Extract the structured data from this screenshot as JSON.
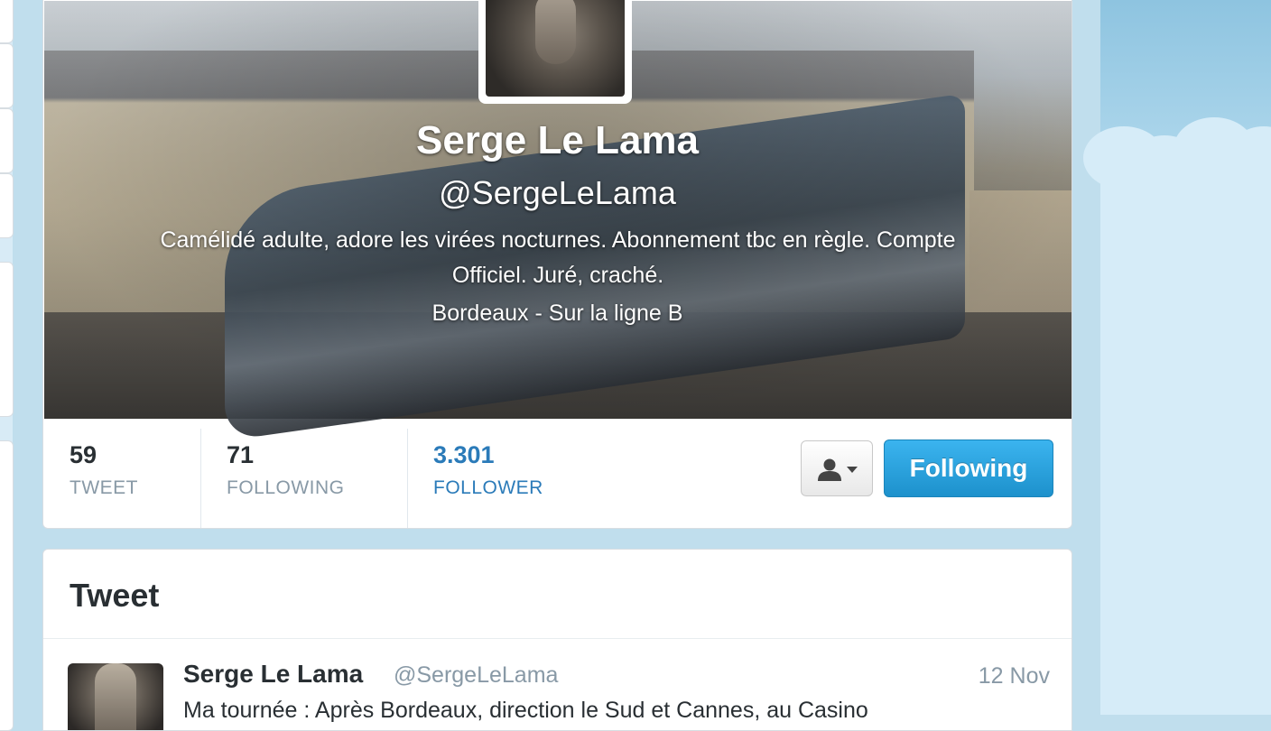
{
  "profile": {
    "name": "Serge Le Lama",
    "handle": "@SergeLeLama",
    "bio": "Camélidé adulte, adore les virées nocturnes. Abonnement tbc en règle. Compte Officiel. Juré, craché.",
    "location": "Bordeaux - Sur la ligne B"
  },
  "stats": [
    {
      "value": "59",
      "label": "TWEET"
    },
    {
      "value": "71",
      "label": "FOLLOWING"
    },
    {
      "value": "3.301",
      "label": "FOLLOWER"
    }
  ],
  "actions": {
    "user_actions_icon": "user-icon",
    "follow_state_label": "Following"
  },
  "timeline": {
    "heading": "Tweet",
    "tweets": [
      {
        "name": "Serge Le Lama",
        "handle": "@SergeLeLama",
        "time": "12 Nov",
        "text": "Ma tournée : Après Bordeaux, direction le Sud et Cannes, au Casino"
      }
    ]
  },
  "colors": {
    "accent": "#2b7bb9",
    "button_blue": "#1d91cc",
    "background": "#c0deed"
  }
}
